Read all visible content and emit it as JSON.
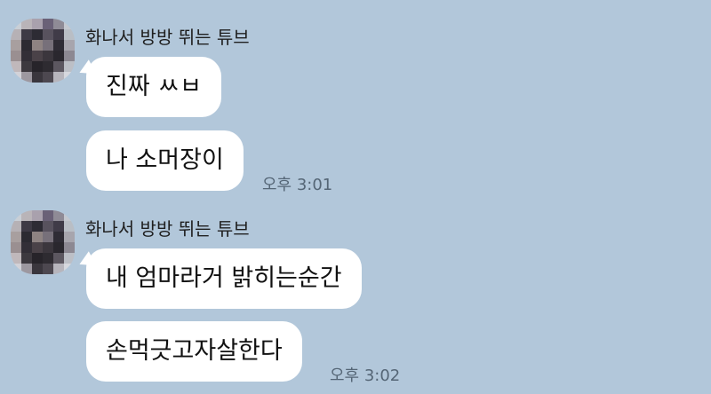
{
  "chat": {
    "groups": [
      {
        "sender": "화나서 방방 뛰는 튜브",
        "messages": [
          "진짜 ㅆㅂ",
          "나 소머장이"
        ],
        "time": "오후 3:01"
      },
      {
        "sender": "화나서 방방 뛰는 튜브",
        "messages": [
          "내 엄마라거 밝히는순간",
          "손먹긋고자살한다"
        ],
        "time": "오후 3:02"
      }
    ]
  },
  "colors": {
    "background": "#b2c7da",
    "bubble": "#ffffff",
    "timestamp": "#556676"
  },
  "icons": {
    "avatar": "pixelated-profile-avatar"
  }
}
